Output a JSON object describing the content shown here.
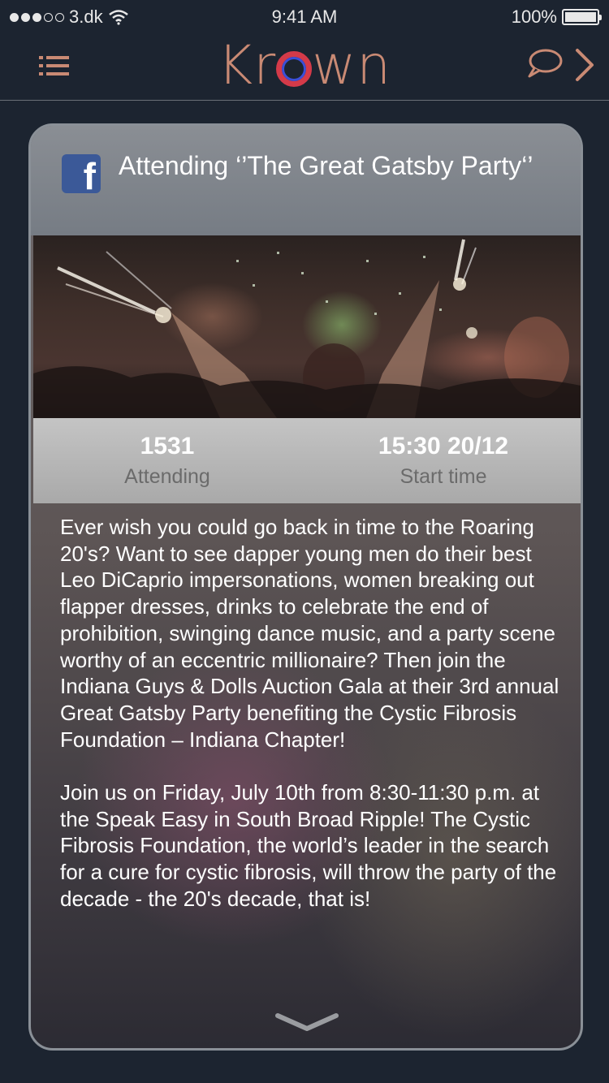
{
  "status_bar": {
    "carrier": "3.dk",
    "time": "9:41 AM",
    "battery_text": "100%",
    "signal_bars_filled": 3,
    "signal_bars_total": 5
  },
  "nav": {
    "logo": "Krown",
    "logo_prefix": "Kr",
    "logo_suffix": "wn"
  },
  "card": {
    "source_icon": "facebook-icon",
    "title": "Attending ‘’The Great Gatsby Party‘’",
    "stats": {
      "attending_value": "1531",
      "attending_label": "Attending",
      "start_value": "15:30 20/12",
      "start_label": "Start time"
    },
    "description": [
      "Ever wish you could go back in time to the Roaring 20's? Want to see dapper young men do their best Leo DiCaprio impersonations, women breaking out flapper dresses, drinks to celebrate the end of prohibition, swinging dance music, and a party scene worthy of an eccentric millionaire? Then join the Indiana Guys & Dolls Auction Gala at their 3rd annual Great Gatsby Party benefiting the Cystic Fibrosis Foundation – Indiana Chapter!",
      "Join us on Friday, July 10th from 8:30-11:30 p.m. at the Speak Easy in South Broad Ripple! The Cystic Fibrosis Foundation, the world’s leader in the search for a cure for cystic fibrosis, will throw the party of the decade - the 20's decade, that is!"
    ]
  },
  "colors": {
    "background": "#1c2430",
    "accent": "#c98a74",
    "logo_ring": "#d43a49",
    "facebook": "#3b5998"
  }
}
